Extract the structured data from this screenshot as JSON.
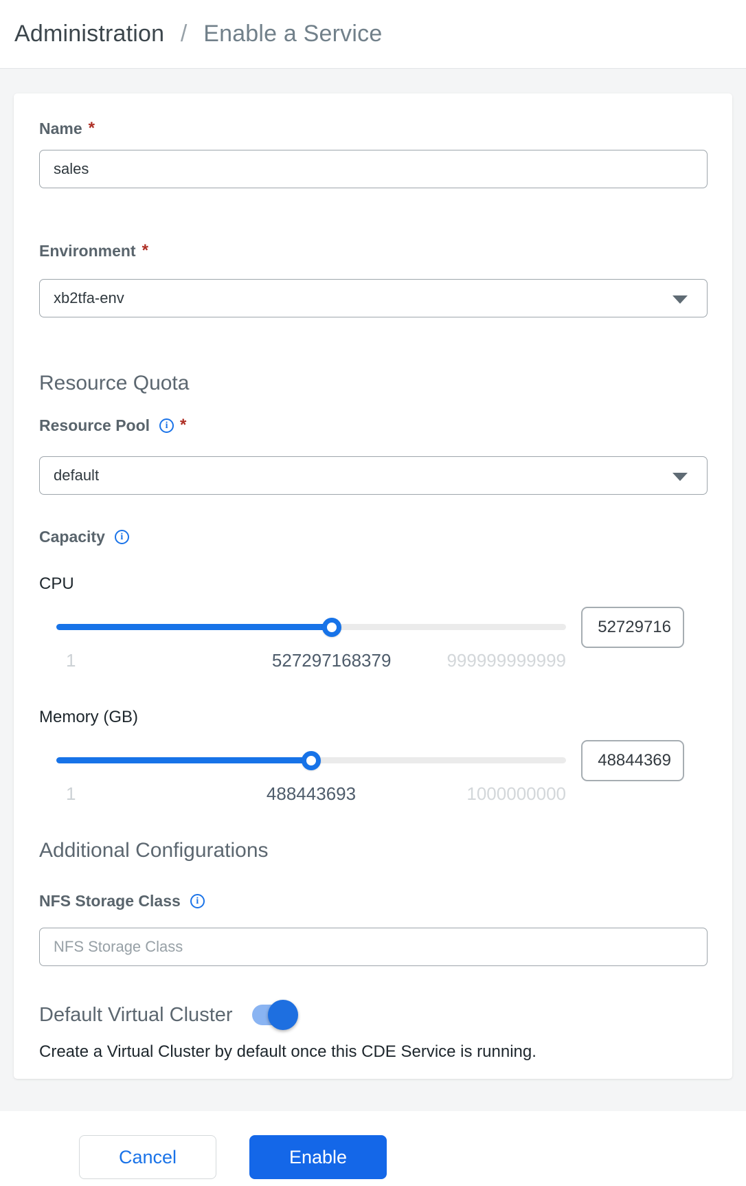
{
  "breadcrumb": {
    "section": "Administration",
    "separator": "/",
    "page": "Enable a Service"
  },
  "form": {
    "name": {
      "label": "Name",
      "required_mark": "*",
      "value": "sales"
    },
    "environment": {
      "label": "Environment",
      "required_mark": "*",
      "value": "xb2tfa-env"
    },
    "resource_quota": {
      "heading": "Resource Quota",
      "resource_pool": {
        "label": "Resource Pool",
        "required_mark": "*",
        "value": "default",
        "info_icon": "i"
      },
      "capacity": {
        "label": "Capacity",
        "info_icon": "i",
        "cpu": {
          "label": "CPU",
          "input_value": "52729716",
          "min_tick": "1",
          "current_tick": "527297168379",
          "max_tick": "999999999999",
          "fill_percent": 54
        },
        "memory": {
          "label": "Memory (GB)",
          "input_value": "48844369",
          "min_tick": "1",
          "current_tick": "488443693",
          "max_tick": "1000000000",
          "fill_percent": 50
        }
      }
    },
    "additional": {
      "heading": "Additional Configurations",
      "nfs": {
        "label": "NFS Storage Class",
        "placeholder": "NFS Storage Class",
        "info_icon": "i"
      },
      "default_virtual_cluster": {
        "label": "Default Virtual Cluster",
        "state": "on",
        "description": "Create a Virtual Cluster by default once this CDE Service is running."
      }
    }
  },
  "footer": {
    "cancel_label": "Cancel",
    "enable_label": "Enable"
  },
  "colors": {
    "accent_blue": "#1a73e8",
    "slider_blue": "#1773e8",
    "button_blue": "#1467e8",
    "toggle_track_blue": "#8ab4f2",
    "toggle_thumb_blue": "#1e6fe0",
    "required_red": "#ae2e24",
    "label_gray": "#59646c",
    "page_bg": "#f4f5f6"
  }
}
